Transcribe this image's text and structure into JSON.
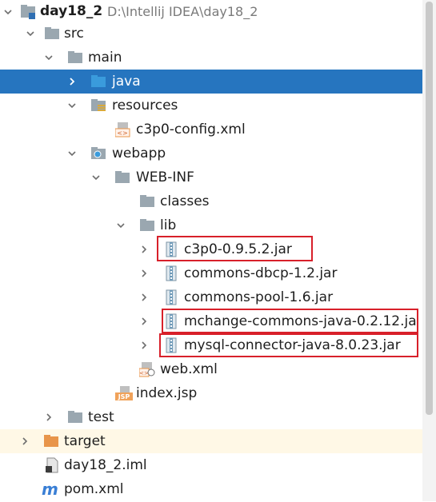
{
  "project": {
    "name": "day18_2",
    "path": "D:\\Intellij IDEA\\day18_2"
  },
  "nodes": {
    "src": "src",
    "main": "main",
    "java": "java",
    "resources": "resources",
    "c3p0_config": "c3p0-config.xml",
    "webapp": "webapp",
    "webinf": "WEB-INF",
    "classes": "classes",
    "lib": "lib",
    "jar1": "c3p0-0.9.5.2.jar",
    "jar2": "commons-dbcp-1.2.jar",
    "jar3": "commons-pool-1.6.jar",
    "jar4": "mchange-commons-java-0.2.12.ja",
    "jar5": "mysql-connector-java-8.0.23.jar",
    "webxml": "web.xml",
    "indexjsp": "index.jsp",
    "test": "test",
    "target": "target",
    "iml": "day18_2.iml",
    "pom": "pom.xml"
  },
  "icon_text": {
    "xml": "<>",
    "jsp": "JSP",
    "m": "m"
  },
  "colors": {
    "selection": "#2675bf",
    "highlight_border": "#d8202a",
    "folder": "#9aa7b0",
    "source_folder": "#3a9bdc",
    "excluded_folder": "#e8954a"
  }
}
